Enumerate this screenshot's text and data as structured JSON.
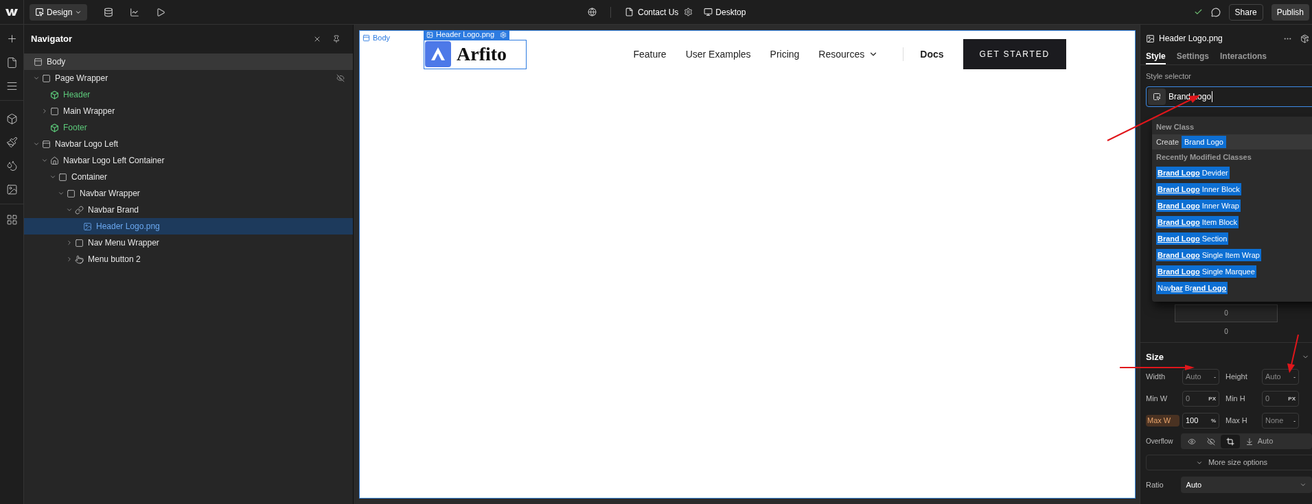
{
  "toolbar": {
    "mode_button": "Design",
    "page": "Contact Us",
    "breakpoint": "Desktop",
    "share": "Share",
    "publish": "Publish"
  },
  "navigator": {
    "title": "Navigator",
    "tree": [
      {
        "label": "Body",
        "kind": "body",
        "selected": false,
        "children": [
          {
            "label": "Page Wrapper",
            "kind": "box",
            "selected": false,
            "expanded": true,
            "hidden": true,
            "children": [
              {
                "label": "Header",
                "kind": "component",
                "color": "#5cc97a",
                "selected": false
              },
              {
                "label": "Main Wrapper",
                "kind": "box",
                "selected": false,
                "expanded": false
              },
              {
                "label": "Footer",
                "kind": "component",
                "color": "#5cc97a",
                "selected": false
              }
            ]
          },
          {
            "label": "Navbar Logo Left",
            "kind": "section",
            "selected": false,
            "expanded": true,
            "children": [
              {
                "label": "Navbar Logo Left Container",
                "kind": "house",
                "selected": false,
                "expanded": true,
                "children": [
                  {
                    "label": "Container",
                    "kind": "box",
                    "selected": false,
                    "expanded": true,
                    "children": [
                      {
                        "label": "Navbar Wrapper",
                        "kind": "box",
                        "selected": false,
                        "expanded": true,
                        "children": [
                          {
                            "label": "Navbar Brand",
                            "kind": "link",
                            "selected": false,
                            "expanded": true,
                            "children": [
                              {
                                "label": "Header Logo.png",
                                "kind": "image",
                                "selected": true
                              }
                            ]
                          },
                          {
                            "label": "Nav Menu Wrapper",
                            "kind": "box",
                            "selected": false,
                            "expanded": false
                          },
                          {
                            "label": "Menu button 2",
                            "kind": "hand",
                            "selected": false,
                            "expanded": false
                          }
                        ]
                      }
                    ]
                  }
                ]
              }
            ]
          }
        ]
      }
    ]
  },
  "canvas": {
    "body_label": "Body",
    "selection_label": "Header Logo.png",
    "logo_text": "Arfito",
    "nav_links": [
      {
        "label": "Feature",
        "kind": "link"
      },
      {
        "label": "User Examples",
        "kind": "link"
      },
      {
        "label": "Pricing",
        "kind": "link"
      },
      {
        "label": "Resources",
        "kind": "dropdown"
      },
      {
        "label": "Docs",
        "kind": "bold"
      }
    ],
    "cta": "GET STARTED"
  },
  "inspector": {
    "element": "Header Logo.png",
    "tabs": [
      {
        "label": "Style",
        "selected": true
      },
      {
        "label": "Settings",
        "selected": false
      },
      {
        "label": "Interactions",
        "selected": false
      }
    ],
    "selector_label": "Style selector",
    "selector_value": "Brand Logo",
    "dropdown": {
      "new_class_heading": "New Class",
      "create_label": "Create",
      "create_chip": "Brand Logo",
      "recent_heading": "Recently Modified Classes",
      "classes": [
        "**Brand Logo** Devider",
        "**Brand Logo** Inner Block",
        "**Brand Logo** Inner Wrap",
        "**Brand Logo** Item Block",
        "**Brand Logo** Section",
        "**Brand Logo** Single Item Wrap",
        "**Brand Logo** Single Marquee",
        "Nav**bar** Br**and Logo**"
      ]
    },
    "spacing_values": [
      "0",
      "0"
    ],
    "size": {
      "title": "Size",
      "fields": [
        {
          "label": "Width",
          "placeholder": "Auto",
          "unit": "-",
          "modified": false
        },
        {
          "label": "Height",
          "placeholder": "Auto",
          "unit": "-",
          "modified": false
        },
        {
          "label": "Min W",
          "placeholder": "0",
          "unit": "PX",
          "modified": false
        },
        {
          "label": "Min H",
          "placeholder": "0",
          "unit": "PX",
          "modified": false
        },
        {
          "label": "Max W",
          "value": "100",
          "unit": "%",
          "modified": true
        },
        {
          "label": "Max H",
          "placeholder": "None",
          "unit": "-",
          "modified": false
        }
      ],
      "overflow": {
        "label": "Overflow",
        "options": [
          {
            "kind": "visible",
            "selected": false
          },
          {
            "kind": "hidden",
            "selected": false
          },
          {
            "kind": "scroll",
            "selected": true
          },
          {
            "kind": "auto",
            "label": "Auto",
            "selected": false
          }
        ]
      },
      "more_button": "More size options",
      "ratio": {
        "label": "Ratio",
        "value": "Auto"
      }
    }
  }
}
